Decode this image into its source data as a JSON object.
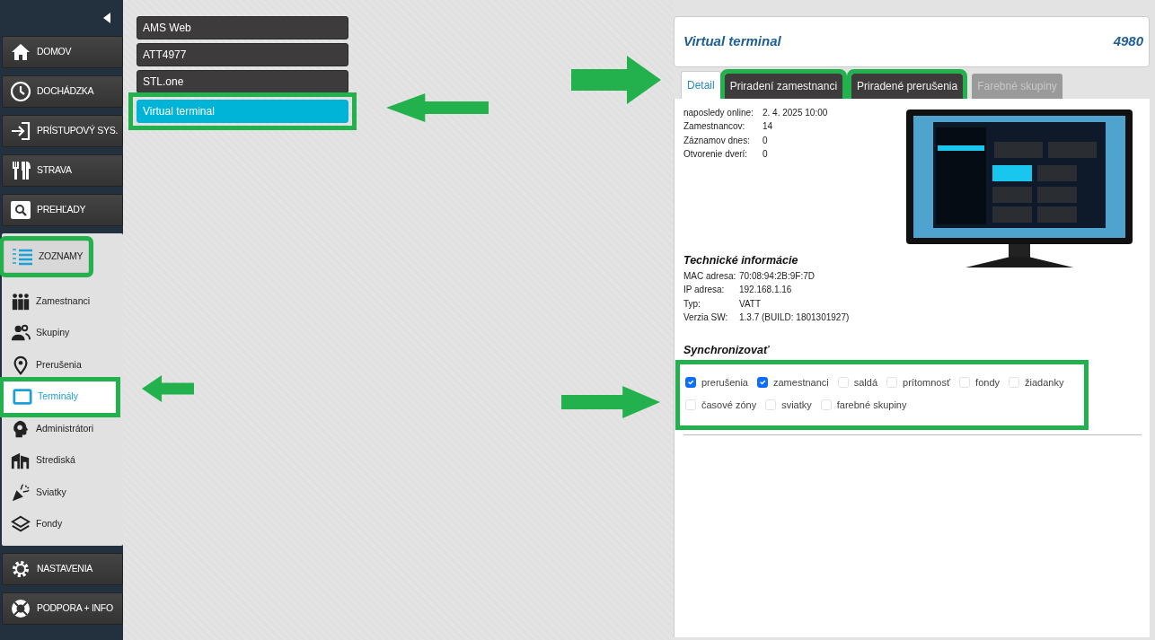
{
  "sidebar": {
    "menu": [
      {
        "label": "DOMOV",
        "expanded": false,
        "highlighted": false
      },
      {
        "label": "DOCHÁDZKA",
        "expanded": false,
        "highlighted": false
      },
      {
        "label": "PRÍSTUPOVÝ SYS.",
        "expanded": false,
        "highlighted": false
      },
      {
        "label": "STRAVA",
        "expanded": false,
        "highlighted": false
      },
      {
        "label": "PREHĽADY",
        "expanded": false,
        "highlighted": false
      },
      {
        "label": "ZOZNAMY",
        "expanded": true,
        "highlighted": true,
        "children": [
          {
            "label": "Zamestnanci",
            "selected": false,
            "highlighted": false
          },
          {
            "label": "Skupiny",
            "selected": false,
            "highlighted": false
          },
          {
            "label": "Prerušenia",
            "selected": false,
            "highlighted": false
          },
          {
            "label": "Terminály",
            "selected": true,
            "highlighted": true
          },
          {
            "label": "Administrátori",
            "selected": false,
            "highlighted": false
          },
          {
            "label": "Strediská",
            "selected": false,
            "highlighted": false
          },
          {
            "label": "Sviatky",
            "selected": false,
            "highlighted": false
          },
          {
            "label": "Fondy",
            "selected": false,
            "highlighted": false
          }
        ]
      },
      {
        "label": "NASTAVENIA",
        "expanded": false,
        "highlighted": false
      },
      {
        "label": "PODPORA + INFO",
        "expanded": false,
        "highlighted": false
      }
    ]
  },
  "terminals": [
    {
      "label": "AMS Web",
      "selected": false,
      "highlighted": false
    },
    {
      "label": "ATT4977",
      "selected": false,
      "highlighted": false
    },
    {
      "label": "STL.one",
      "selected": false,
      "highlighted": false
    },
    {
      "label": "Virtual terminal",
      "selected": true,
      "highlighted": true
    }
  ],
  "detail": {
    "title": "Virtual terminal",
    "number": "4980",
    "tabs": [
      {
        "label": "Detail",
        "selected": true,
        "disabled": false,
        "highlighted": false
      },
      {
        "label": "Priradení zamestnanci",
        "selected": false,
        "disabled": false,
        "highlighted": true
      },
      {
        "label": "Priradené prerušenia",
        "selected": false,
        "disabled": false,
        "highlighted": true
      },
      {
        "label": "Farebné skupiny",
        "selected": false,
        "disabled": true,
        "highlighted": false
      }
    ],
    "info": [
      {
        "label": "naposledy online:",
        "value": "2. 4. 2025 10:00"
      },
      {
        "label": "Zamestnancov:",
        "value": "14"
      },
      {
        "label": "Záznamov dnes:",
        "value": "0"
      },
      {
        "label": "Otvorenie dverí:",
        "value": "0"
      }
    ],
    "technical": {
      "title": "Technické informácie",
      "rows": [
        {
          "label": "MAC adresa:",
          "value": "70:08:94:2B:9F:7D"
        },
        {
          "label": "IP adresa:",
          "value": "192.168.1.16"
        },
        {
          "label": "Typ:",
          "value": "VATT"
        },
        {
          "label": "Verzia SW:",
          "value": "1.3.7 (BUILD: 1801301927)"
        }
      ]
    },
    "sync": {
      "title": "Synchronizovať",
      "highlighted": true,
      "options": [
        {
          "label": "prerušenia",
          "checked": true
        },
        {
          "label": "zamestnanci",
          "checked": true
        },
        {
          "label": "saldá",
          "checked": false
        },
        {
          "label": "prítomnosť",
          "checked": false
        },
        {
          "label": "fondy",
          "checked": false
        },
        {
          "label": "žiadanky",
          "checked": false
        },
        {
          "label": "časové zóny",
          "checked": false
        },
        {
          "label": "sviatky",
          "checked": false
        },
        {
          "label": "farebné skupiny",
          "checked": false
        }
      ]
    }
  }
}
